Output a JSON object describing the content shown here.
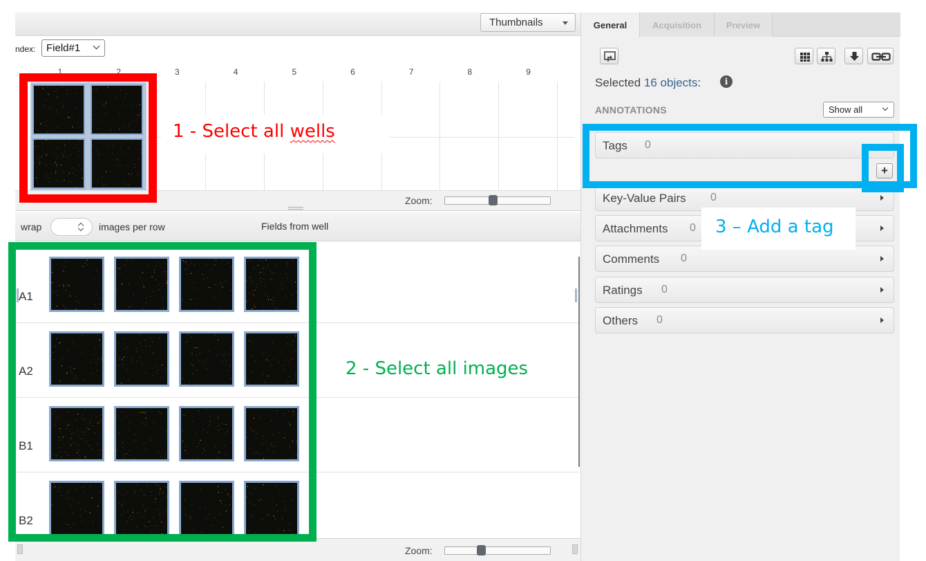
{
  "left_pane": {
    "view_mode": "Thumbnails",
    "index_label": "ndex:",
    "field_index": "Field#1",
    "plate": {
      "columns": [
        "1",
        "2",
        "3",
        "4",
        "5",
        "6",
        "7",
        "8",
        "9"
      ]
    },
    "zoom_label": "Zoom:",
    "plate_zoom": 0.45,
    "wrap_label": "wrap",
    "per_row_label": "images per row",
    "fields_title": "Fields from well",
    "wells": [
      {
        "label": "A1"
      },
      {
        "label": "A2"
      },
      {
        "label": "B1"
      },
      {
        "label": "B2"
      }
    ],
    "fields_zoom": 0.33
  },
  "right_pane": {
    "tabs": [
      {
        "label": "General",
        "active": true
      },
      {
        "label": "Acquisition",
        "active": false
      },
      {
        "label": "Preview",
        "active": false
      }
    ],
    "toolbar_icons": [
      "open-with-icon",
      "grid-icon",
      "hierarchy-icon",
      "download-icon",
      "link-icon"
    ],
    "selection": {
      "prefix": "Selected",
      "count_text": "16 objects",
      "suffix": ":"
    },
    "annotations": {
      "heading": "ANNOTATIONS",
      "filter": "Show all",
      "sections": [
        {
          "title": "Tags",
          "count": "0"
        },
        {
          "title": "Key-Value Pairs",
          "count": "0"
        },
        {
          "title": "Attachments",
          "count": "0"
        },
        {
          "title": "Comments",
          "count": "0"
        },
        {
          "title": "Ratings",
          "count": "0"
        },
        {
          "title": "Others",
          "count": "0"
        }
      ],
      "add_tag_symbol": "+"
    }
  },
  "callouts": {
    "step1_text": "1 - Select all ",
    "step1_word": "wells",
    "step2": "2 - Select all images",
    "step3": "3 – Add a tag"
  },
  "colors": {
    "step1": "#ff0000",
    "step2": "#00b050",
    "step3": "#00b0f0",
    "selected_border": "#8aa8cf",
    "count_link": "#3a6491"
  }
}
